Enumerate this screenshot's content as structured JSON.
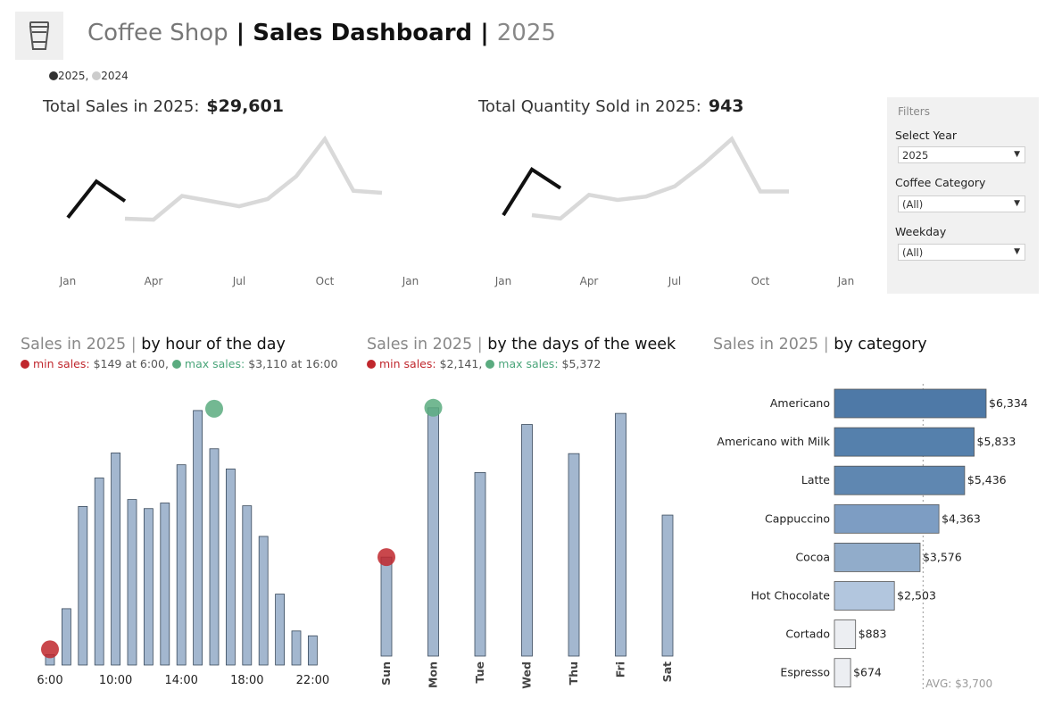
{
  "header": {
    "title_light": "Coffee Shop",
    "title_sep": " | ",
    "title_bold": "Sales Dashboard",
    "title_sep2": " | ",
    "title_year": "2025",
    "logo_icon": "coffee-cup-icon"
  },
  "legend": {
    "items": [
      {
        "label": "2025",
        "color": "#333333"
      },
      {
        "label": "2024",
        "color": "#cccccc"
      }
    ],
    "sep": ","
  },
  "kpis": {
    "sales_label": "Total Sales in 2025:",
    "sales_value": "$29,601",
    "qty_label": "Total Quantity Sold in 2025:",
    "qty_value": "943"
  },
  "filters": {
    "heading": "Filters",
    "year_label": "Select Year",
    "year_value": "2025",
    "category_label": "Coffee Category",
    "category_value": "(All)",
    "weekday_label": "Weekday",
    "weekday_value": "(All)"
  },
  "sections": {
    "hour": {
      "title_light": "Sales in 2025",
      "title_bold": "by hour of the day",
      "min_label": "min sales:",
      "min_value": "$149 at  6:00,",
      "max_label": "max sales:",
      "max_value": "$3,110 at 16:00"
    },
    "week": {
      "title_light": "Sales in 2025",
      "title_bold": "by the days of the week",
      "min_label": "min sales:",
      "min_value": "$2,141,",
      "max_label": "max sales:",
      "max_value": "$5,372"
    },
    "category": {
      "title_light": "Sales in 2025",
      "title_bold": "by category"
    },
    "sep": "|"
  },
  "colors": {
    "bar": "#a3b7cf",
    "bar_stroke": "#3a4a5c",
    "min": "#c0272d",
    "max": "#5aab7f",
    "line_2025": "#111111",
    "line_2024": "#d9d9d9"
  },
  "chart_data": [
    {
      "type": "line",
      "x_ticks": [
        "Jan",
        "Apr",
        "Jul",
        "Oct",
        "Jan"
      ],
      "series": [
        {
          "name": "2025",
          "x": [
            "Jan",
            "Feb",
            "Mar"
          ],
          "values": [
            1400,
            4900,
            3000
          ]
        },
        {
          "name": "2024",
          "x": [
            "Mar",
            "Apr",
            "May",
            "Jun",
            "Jul",
            "Aug",
            "Sep",
            "Oct",
            "Nov",
            "Dec"
          ],
          "values": [
            1300,
            1200,
            3500,
            3000,
            2500,
            3200,
            5400,
            9000,
            4000,
            3800
          ]
        }
      ]
    },
    {
      "type": "line",
      "x_ticks": [
        "Jan",
        "Apr",
        "Jul",
        "Oct",
        "Jan"
      ],
      "series": [
        {
          "name": "2025",
          "x": [
            "Jan",
            "Feb",
            "Mar"
          ],
          "values": [
            50,
            185,
            130
          ]
        },
        {
          "name": "2024",
          "x": [
            "Feb",
            "Mar",
            "Apr",
            "May",
            "Jun",
            "Jul",
            "Aug",
            "Sep",
            "Oct",
            "Nov"
          ],
          "values": [
            50,
            40,
            110,
            95,
            105,
            135,
            200,
            275,
            120,
            120
          ]
        }
      ]
    },
    {
      "type": "bar",
      "categories": [
        "6",
        "7",
        "8",
        "9",
        "10",
        "11",
        "12",
        "13",
        "14",
        "15",
        "16",
        "17",
        "18",
        "19",
        "20",
        "21",
        "22"
      ],
      "tick_labels": [
        "6:00",
        "10:00",
        "14:00",
        "18:00",
        "22:00"
      ],
      "values": [
        149,
        810,
        2280,
        2690,
        3050,
        2380,
        2250,
        2330,
        2880,
        3660,
        3110,
        2820,
        2290,
        1850,
        1020,
        490,
        420
      ],
      "min_index": 0,
      "max_index": 10
    },
    {
      "type": "bar",
      "categories": [
        "Sun",
        "Mon",
        "Tue",
        "Wed",
        "Thu",
        "Fri",
        "Sat"
      ],
      "values": [
        2141,
        5372,
        3970,
        5010,
        4380,
        5250,
        3050
      ],
      "min_index": 0,
      "max_index": 1
    },
    {
      "type": "bar",
      "orientation": "horizontal",
      "categories": [
        "Americano",
        "Americano with Milk",
        "Latte",
        "Cappuccino",
        "Cocoa",
        "Hot Chocolate",
        "Cortado",
        "Espresso"
      ],
      "values": [
        6334,
        5833,
        5436,
        4363,
        3576,
        2503,
        883,
        674
      ],
      "labels": [
        "$6,334",
        "$5,833",
        "$5,436",
        "$4,363",
        "$3,576",
        "$2,503",
        "$883",
        "$674"
      ],
      "avg": 3700,
      "avg_label": "AVG: $3,700",
      "bar_colors": [
        "#4e79a7",
        "#5580ac",
        "#5f87b1",
        "#7d9dc3",
        "#91acca",
        "#b2c6de",
        "#eceef2",
        "#eceef2"
      ]
    }
  ]
}
